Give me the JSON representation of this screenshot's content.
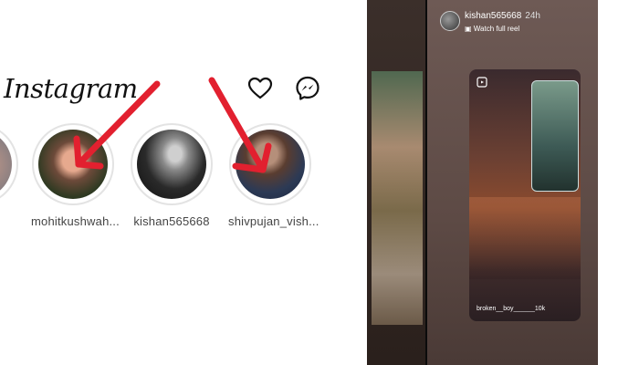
{
  "left_panel": {
    "app_title": "Instagram",
    "icons": {
      "activity": "heart-icon",
      "messages": "messenger-icon"
    },
    "stories": [
      {
        "username": "mohitkushwah..."
      },
      {
        "username": "kishan565668"
      },
      {
        "username": "shivpujan_vish..."
      }
    ]
  },
  "right_panel": {
    "account": "kishan565668",
    "time": "24h",
    "watch_label": "Watch full reel",
    "reel_caption": "broken__boy______10k"
  },
  "colors": {
    "arrow": "#e2202f",
    "cube_face": "#5d4a45"
  }
}
